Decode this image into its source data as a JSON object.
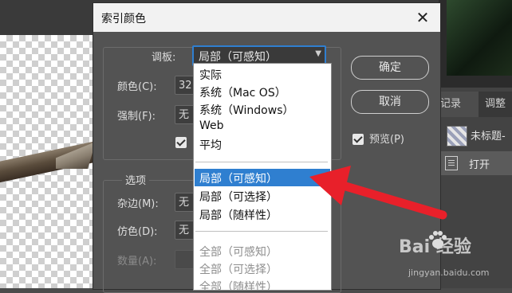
{
  "dialog": {
    "title": "索引颜色",
    "close_glyph": "✕",
    "palette_label": "调板:",
    "palette_value": "局部（可感知）",
    "colors_label": "颜色(C):",
    "colors_value": "32",
    "forced_label": "强制(F):",
    "forced_value": "无",
    "options_title": "选项",
    "matte_label": "杂边(M):",
    "matte_value": "无",
    "dither_label": "仿色(D):",
    "dither_value": "无",
    "amount_label": "数量(A):",
    "ok_label": "确定",
    "cancel_label": "取消",
    "preview_label": "预览(P)"
  },
  "dropdown": {
    "items": [
      {
        "label": "实际"
      },
      {
        "label": "系统（Mac OS）"
      },
      {
        "label": "系统（Windows）"
      },
      {
        "label": "Web"
      },
      {
        "label": "平均"
      },
      {
        "label": "局部（可感知）"
      },
      {
        "label": "局部（可选择）"
      },
      {
        "label": "局部（随样性）"
      },
      {
        "label": "全部（可感知）"
      },
      {
        "label": "全部（可选择）"
      },
      {
        "label": "全部（随样性）"
      }
    ],
    "selected": "局部（可感知）"
  },
  "background": {
    "tab_history": "记录",
    "tab_adjust": "调整",
    "history_item_1": "未标题-",
    "history_item_2": "打开"
  },
  "watermark": {
    "brand": "Bai 经验",
    "url": "jingyan.baidu.com"
  },
  "colors": {
    "accent": "#2f7fd0",
    "arrow": "#e8202a",
    "dialog_bg": "#535353"
  }
}
